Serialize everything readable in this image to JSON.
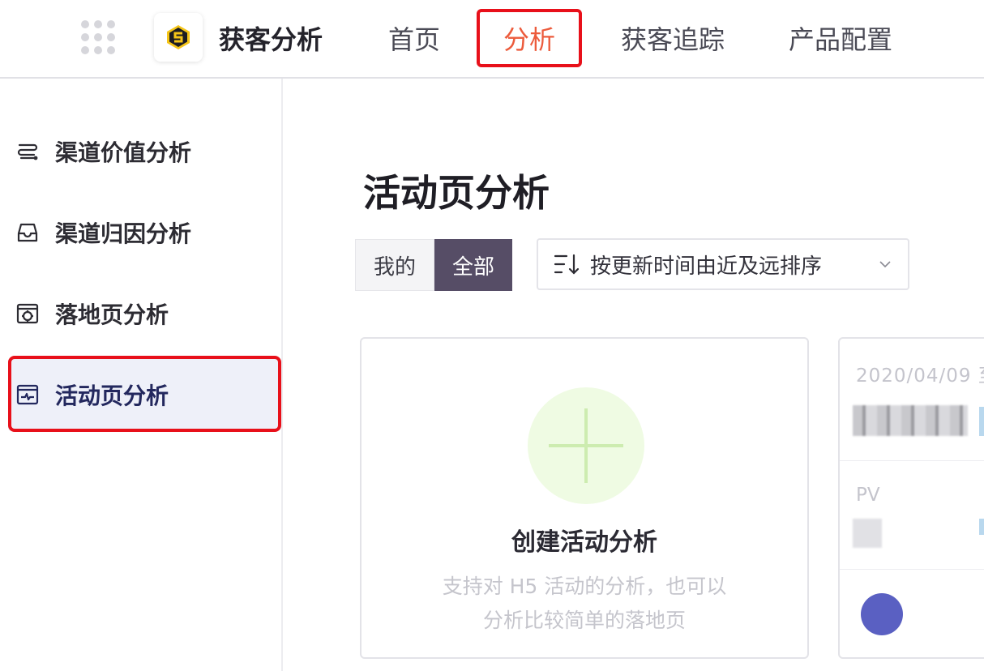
{
  "header": {
    "app_name": "获客分析",
    "nav": [
      {
        "label": "首页",
        "active": false
      },
      {
        "label": "分析",
        "active": true
      },
      {
        "label": "获客追踪",
        "active": false
      },
      {
        "label": "产品配置",
        "active": false
      }
    ]
  },
  "sidebar": {
    "items": [
      {
        "label": "渠道价值分析",
        "icon": "channel-value-icon",
        "active": false
      },
      {
        "label": "渠道归因分析",
        "icon": "inbox-tray-icon",
        "active": false
      },
      {
        "label": "落地页分析",
        "icon": "target-window-icon",
        "active": false
      },
      {
        "label": "活动页分析",
        "icon": "pulse-window-icon",
        "active": true
      }
    ]
  },
  "main": {
    "title": "活动页分析",
    "filter_tabs": [
      {
        "label": "我的",
        "active": false
      },
      {
        "label": "全部",
        "active": true
      }
    ],
    "sort": {
      "label": "按更新时间由近及远排序",
      "icon": "sort-icon"
    },
    "create_card": {
      "title": "创建活动分析",
      "desc_line1": "支持对 H5 活动的分析，也可以",
      "desc_line2": "分析比较简单的落地页"
    },
    "activity_card": {
      "date": "2020/04/09 至",
      "metric_label": "PV"
    }
  },
  "colors": {
    "nav_active": "#ec5b3c",
    "highlight_box": "#e8101a",
    "segment_active_bg": "#564d66",
    "sidebar_active_bg": "#eef0f9",
    "sidebar_active_text": "#23285e",
    "plus_bg": "#effbe3"
  }
}
